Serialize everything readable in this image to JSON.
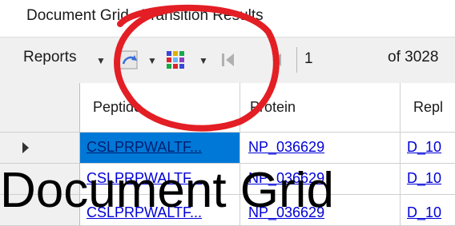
{
  "window": {
    "title": "Document Grid - Transition Results"
  },
  "toolbar": {
    "reports_label": "Reports",
    "page_number": "1",
    "of_label": "of 3028",
    "icons": [
      "dropdown-arrow-icon",
      "refresh-icon",
      "column-chooser-icon",
      "first-page-icon",
      "previous-page-icon"
    ]
  },
  "grid": {
    "columns": [
      "",
      "Peptide",
      "Protein",
      "Repl"
    ],
    "rows": [
      {
        "peptide": "CSLPRPWALTF...",
        "protein": "NP_036629",
        "replicate": "D_10",
        "selected": true
      },
      {
        "peptide": "CSLPRPWALTF...",
        "protein": "NP_036629",
        "replicate": "D_10",
        "selected": false
      },
      {
        "peptide": "CSLPRPWALTF...",
        "protein": "NP_036629",
        "replicate": "D_10",
        "selected": false
      }
    ]
  },
  "caption": {
    "text": "Document Grid"
  },
  "colors": {
    "highlight": "#e31e24",
    "link": "#0000d8",
    "selection": "#0078d7"
  }
}
